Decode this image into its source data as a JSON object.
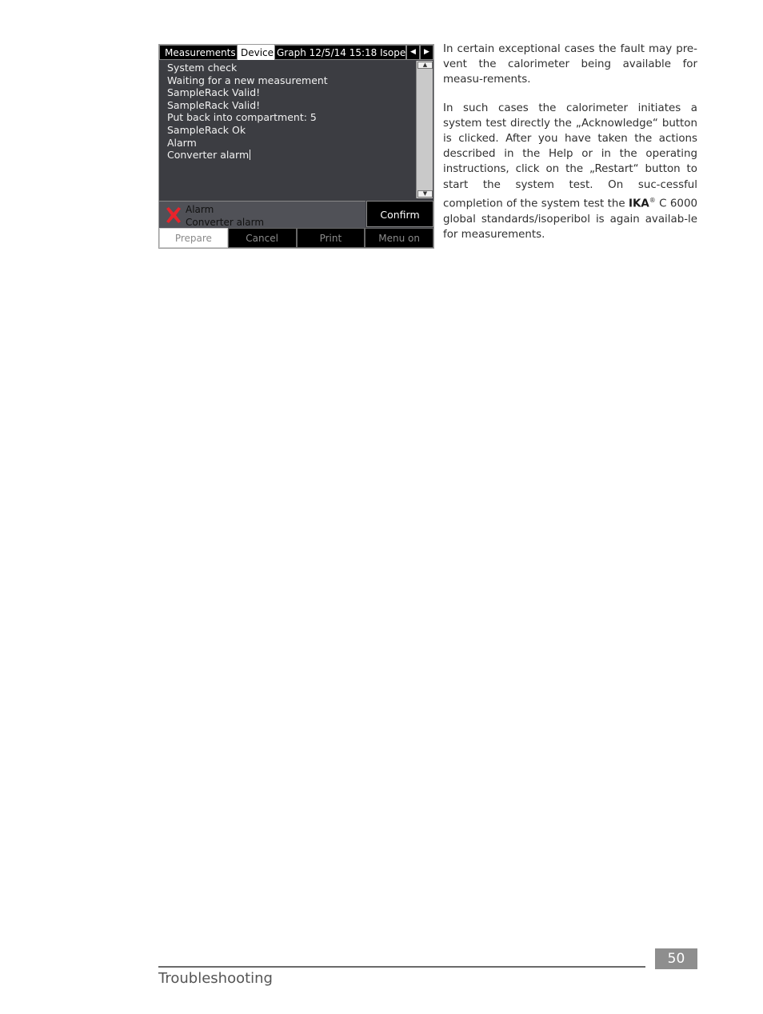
{
  "device": {
    "tabs": {
      "measurements": "Measurements",
      "device": "Device",
      "graph": "Graph  12/5/14 15:18 Isope",
      "prev_arrow": "◀",
      "next_arrow": "▶"
    },
    "log_lines": [
      "System check",
      "Waiting for a new measurement",
      "SampleRack Valid!",
      "SampleRack Valid!",
      "Put back into compartment: 5",
      "SampleRack Ok",
      "Alarm",
      "Converter alarm"
    ],
    "scroll_up": "▲",
    "scroll_down": "▼",
    "alarm": {
      "icon": "red-x-icon",
      "icon_color": "#e8232b",
      "title": "Alarm",
      "message": "Converter alarm"
    },
    "confirm_label": "Confirm",
    "softkeys": [
      "Prepare",
      "Cancel",
      "Print",
      "Menu on"
    ]
  },
  "text": {
    "p1": "In certain exceptional cases the fault may pre-vent the calorimeter being available for measu-rements.",
    "p2_before_brand": "In such cases the calorimeter initiates a system test directly the „Acknowledge“ button is clicked. After you have taken the actions described in the Help or in the operating instructions, click on the „Restart“ button to start the system test. On suc-cessful completion of the system test the ",
    "brand": "IKA",
    "brand_mark": "®",
    "p2_after_brand": " C 6000 global standards/isoperibol is again availab-le for measurements."
  },
  "footer": {
    "page_number": "50",
    "section_title": "Troubleshooting"
  }
}
